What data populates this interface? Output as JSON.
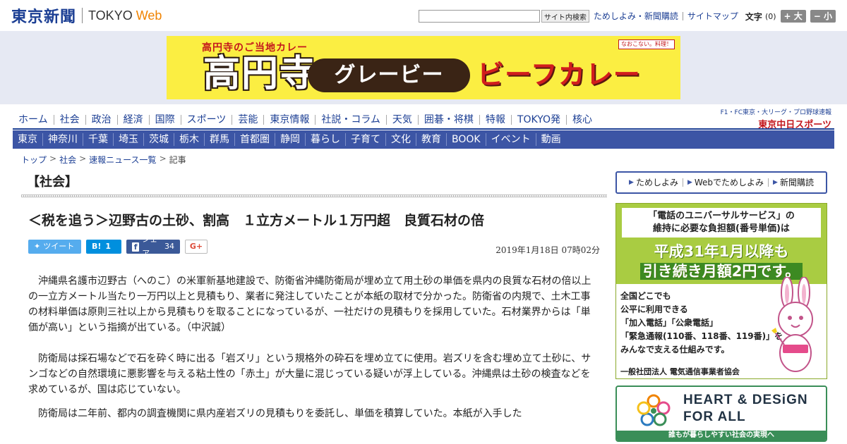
{
  "header": {
    "logo_jp": "東京新聞",
    "logo_tokyo": "TOKYO",
    "logo_web": "Web",
    "search_placeholder": "",
    "search_button": "サイト内検索",
    "links": [
      "ためしよみ・新聞購読",
      "サイトマップ"
    ],
    "font_label": "文字",
    "font_value": "(0)",
    "font_bigger": "+ 大",
    "font_smaller": "− 小"
  },
  "banner": {
    "tag": "高円寺のご当地カレー",
    "big": "高円寺",
    "pill": "グレービー",
    "red": "ビーフカレー",
    "badge": "なおこない。料理！"
  },
  "nav_primary": [
    "ホーム",
    "社会",
    "政治",
    "経済",
    "国際",
    "スポーツ",
    "芸能",
    "東京情報",
    "社説・コラム",
    "天気",
    "囲碁・将棋",
    "特報",
    "TOKYO発",
    "核心"
  ],
  "sports": {
    "line1": "F1・FC東京・大リーグ・プロ野球速報",
    "line2_a": "東京",
    "line2_b": "中日スポーツ"
  },
  "nav_regional": [
    "東京",
    "神奈川",
    "千葉",
    "埼玉",
    "茨城",
    "栃木",
    "群馬",
    "首都圏",
    "静岡",
    "暮らし",
    "子育て",
    "文化",
    "教育",
    "BOOK",
    "イベント",
    "動画"
  ],
  "breadcrumb": [
    "トップ",
    "社会",
    "速報ニュース一覧",
    "記事"
  ],
  "article": {
    "section": "【社会】",
    "headline": "＜税を追う＞辺野古の土砂、割高　１立方メートル１万円超　良質石材の倍",
    "share": {
      "tweet": "ツイート",
      "hatena": "B!",
      "hatena_count": "1",
      "facebook": "シェア",
      "facebook_count": "34",
      "gplus": "G+"
    },
    "date": "2019年1月18日 07時02分",
    "paragraphs": [
      "沖縄県名護市辺野古（へのこ）の米軍新基地建設で、防衛省沖縄防衛局が埋め立て用土砂の単価を県内の良質な石材の倍以上の一立方メートル当たり一万円以上と見積もり、業者に発注していたことが本紙の取材で分かった。防衛省の内規で、土木工事の材料単価は原則三社以上から見積もりを取ることになっているが、一社だけの見積もりを採用していた。石材業界からは「単価が高い」という指摘が出ている。（中沢誠）",
      "防衛局は採石場などで石を砕く時に出る「岩ズリ」という規格外の砕石を埋め立てに使用。岩ズリを含む埋め立て土砂に、サンゴなどの自然環境に悪影響を与える粘土性の「赤土」が大量に混じっている疑いが浮上している。沖縄県は土砂の検査などを求めているが、国は応じていない。",
      "防衛局は二年前、都内の調査機関に県内産岩ズリの見積もりを委託し、単価を積算していた。本紙が入手した"
    ]
  },
  "sidebar": {
    "links": [
      "ためしよみ",
      "Webでためしよみ",
      "新聞購読"
    ],
    "ad1": {
      "top_a": "「電話のユニバーサルサービス」の",
      "top_b": "維持に必要な負担額(番号単価)は",
      "big1": "平成31年1月以降も",
      "big2": "引き続き月額2円です。",
      "l1": "全国どこでも",
      "l2": "公平に利用できる",
      "l3": "「加入電話」「公衆電話」",
      "l4": "「緊急通報(110番、118番、119番)」を",
      "l5": "みんなで支える仕組みです。",
      "sign": "一般社団法人 電気通信事業者協会"
    },
    "ad2": {
      "t1": "HEART & DESiGN",
      "t2": "FOR ALL",
      "foot": "誰もが暮らしやすい社会の実現へ"
    }
  },
  "colors": {
    "brand_blue": "#1c3f94",
    "nav_blue": "#3c55a5",
    "accent_orange": "#f08300"
  }
}
